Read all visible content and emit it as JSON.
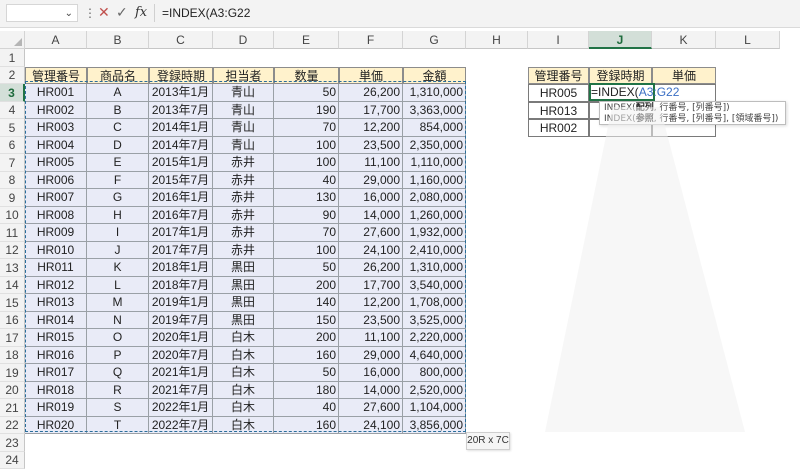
{
  "formula_bar": {
    "name_box": "",
    "name_box_chevron": "⌄",
    "more_icon": "⋮",
    "cancel_icon": "✕",
    "confirm_icon": "✓",
    "fx_label": "fx",
    "formula": "=INDEX(A3:G22"
  },
  "columns": [
    "A",
    "B",
    "C",
    "D",
    "E",
    "F",
    "G",
    "H",
    "I",
    "J",
    "K",
    "L"
  ],
  "active_column": "J",
  "rows": [
    "1",
    "2",
    "3",
    "4",
    "5",
    "6",
    "7",
    "8",
    "9",
    "10",
    "11",
    "12",
    "13",
    "14",
    "15",
    "16",
    "17",
    "18",
    "19",
    "20",
    "21",
    "22",
    "23",
    "24"
  ],
  "active_row": "3",
  "main_table": {
    "headers": [
      "管理番号",
      "商品名",
      "登録時期",
      "担当者",
      "数量",
      "単価",
      "金額"
    ],
    "rows": [
      [
        "HR001",
        "A",
        "2013年1月",
        "青山",
        "50",
        "26,200",
        "1,310,000"
      ],
      [
        "HR002",
        "B",
        "2013年7月",
        "青山",
        "190",
        "17,700",
        "3,363,000"
      ],
      [
        "HR003",
        "C",
        "2014年1月",
        "青山",
        "70",
        "12,200",
        "854,000"
      ],
      [
        "HR004",
        "D",
        "2014年7月",
        "青山",
        "100",
        "23,500",
        "2,350,000"
      ],
      [
        "HR005",
        "E",
        "2015年1月",
        "赤井",
        "100",
        "11,100",
        "1,110,000"
      ],
      [
        "HR006",
        "F",
        "2015年7月",
        "赤井",
        "40",
        "29,000",
        "1,160,000"
      ],
      [
        "HR007",
        "G",
        "2016年1月",
        "赤井",
        "130",
        "16,000",
        "2,080,000"
      ],
      [
        "HR008",
        "H",
        "2016年7月",
        "赤井",
        "90",
        "14,000",
        "1,260,000"
      ],
      [
        "HR009",
        "I",
        "2017年1月",
        "赤井",
        "70",
        "27,600",
        "1,932,000"
      ],
      [
        "HR010",
        "J",
        "2017年7月",
        "赤井",
        "100",
        "24,100",
        "2,410,000"
      ],
      [
        "HR011",
        "K",
        "2018年1月",
        "黒田",
        "50",
        "26,200",
        "1,310,000"
      ],
      [
        "HR012",
        "L",
        "2018年7月",
        "黒田",
        "200",
        "17,700",
        "3,540,000"
      ],
      [
        "HR013",
        "M",
        "2019年1月",
        "黒田",
        "140",
        "12,200",
        "1,708,000"
      ],
      [
        "HR014",
        "N",
        "2019年7月",
        "黒田",
        "150",
        "23,500",
        "3,525,000"
      ],
      [
        "HR015",
        "O",
        "2020年1月",
        "白木",
        "200",
        "11,100",
        "2,220,000"
      ],
      [
        "HR016",
        "P",
        "2020年7月",
        "白木",
        "160",
        "29,000",
        "4,640,000"
      ],
      [
        "HR017",
        "Q",
        "2021年1月",
        "白木",
        "50",
        "16,000",
        "800,000"
      ],
      [
        "HR018",
        "R",
        "2021年7月",
        "白木",
        "180",
        "14,000",
        "2,520,000"
      ],
      [
        "HR019",
        "S",
        "2022年1月",
        "白木",
        "40",
        "27,600",
        "1,104,000"
      ],
      [
        "HR020",
        "T",
        "2022年7月",
        "白木",
        "160",
        "24,100",
        "3,856,000"
      ]
    ]
  },
  "lookup_table": {
    "headers": [
      "管理番号",
      "登録時期",
      "単価"
    ],
    "ids": [
      "HR005",
      "HR013",
      "HR002"
    ]
  },
  "cell_edit": {
    "prefix": "=INDEX(",
    "range": "A3:G22"
  },
  "tooltip": {
    "line1_fn": "INDEX(",
    "line1_bold": "配列",
    "line1_rest": ", 行番号, [列番号])",
    "line2_fn": "INDEX(",
    "line2_bold": "参照",
    "line2_rest": ", 行番号, [列番号], [領域番号])"
  },
  "size_badge": "20R x 7C",
  "colors": {
    "header_fill": "#fff2cc",
    "body_fill": "#e9ebf7",
    "selection": "#217346",
    "ref_text": "#3b6fc4"
  }
}
